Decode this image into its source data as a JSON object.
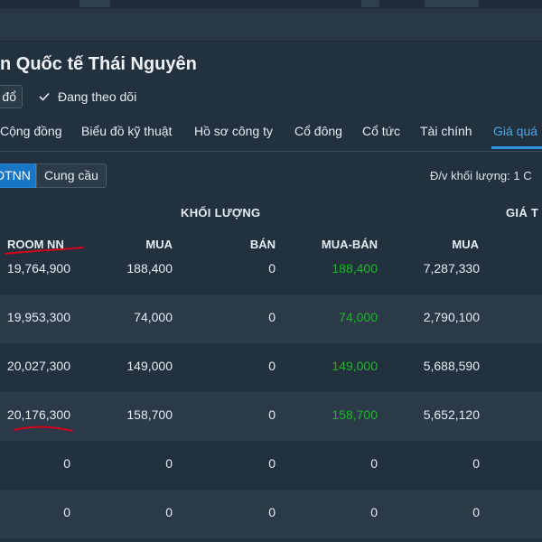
{
  "company": {
    "name": "n Quốc tế Thái Nguyên"
  },
  "actions": {
    "partial_button_label": "đổ",
    "follow_label": "Đang theo dõi"
  },
  "tabs": [
    {
      "label": "Cộng đồng"
    },
    {
      "label": "Biểu đồ kỹ thuật"
    },
    {
      "label": "Hồ sơ công ty"
    },
    {
      "label": "Cổ đông"
    },
    {
      "label": "Cổ tức"
    },
    {
      "label": "Tài chính"
    },
    {
      "label": "Giá quá",
      "active": true
    }
  ],
  "subtabs": [
    {
      "label": "DTNN",
      "active": true
    },
    {
      "label": "Cung cầu"
    }
  ],
  "unit_label": "Đ/v khối lượng: 1 C",
  "table": {
    "group_headers": {
      "volume": "KHỐI LƯỢNG",
      "value": "GIÁ T"
    },
    "columns": {
      "room": "ROOM NN",
      "buy": "MUA",
      "sell": "BÁN",
      "net": "MUA-BÁN",
      "buy_value": "MUA"
    },
    "rows": [
      {
        "room": "19,764,900",
        "buy": "188,400",
        "sell": "0",
        "net": "188,400",
        "buy_value": "7,287,330"
      },
      {
        "room": "19,953,300",
        "buy": "74,000",
        "sell": "0",
        "net": "74,000",
        "buy_value": "2,790,100"
      },
      {
        "room": "20,027,300",
        "buy": "149,000",
        "sell": "0",
        "net": "149,000",
        "buy_value": "5,688,590"
      },
      {
        "room": "20,176,300",
        "buy": "158,700",
        "sell": "0",
        "net": "158,700",
        "buy_value": "5,652,120"
      },
      {
        "room": "0",
        "buy": "0",
        "sell": "0",
        "net": "0",
        "buy_value": "0"
      },
      {
        "room": "0",
        "buy": "0",
        "sell": "0",
        "net": "0",
        "buy_value": "0"
      }
    ]
  },
  "colors": {
    "background": "#23313f",
    "accent": "#2f96e0",
    "positive": "#1fb52a",
    "annotation": "#d0021b"
  }
}
